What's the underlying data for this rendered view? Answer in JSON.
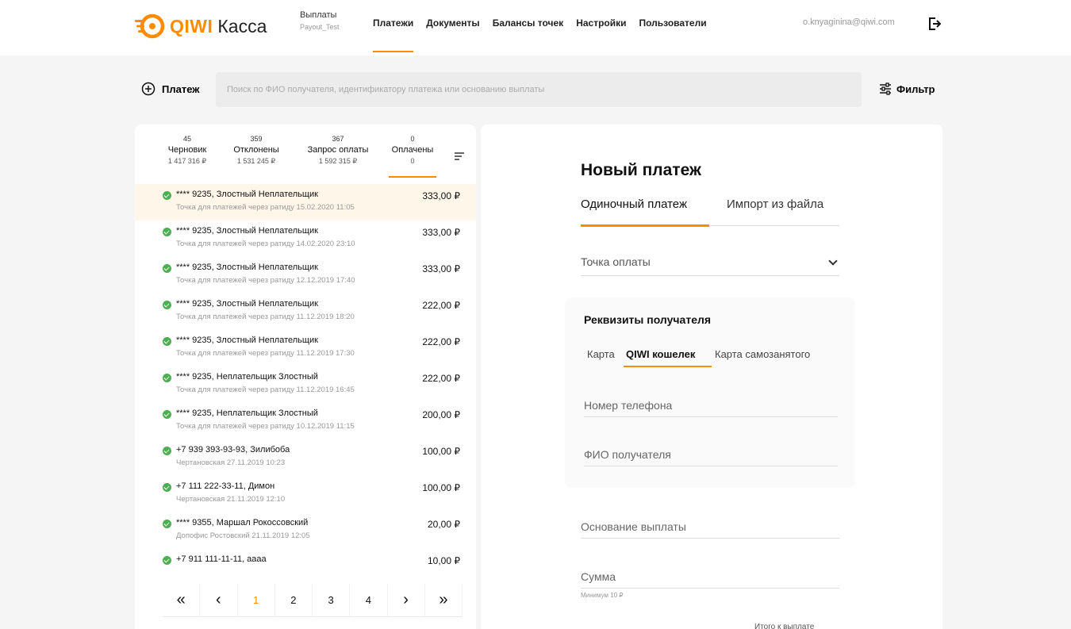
{
  "brand": {
    "name": "QIWI",
    "product": "Касса"
  },
  "payout": {
    "title": "Выплаты",
    "subtitle": "Payout_Test"
  },
  "nav": [
    {
      "label": "Платежи",
      "active": true
    },
    {
      "label": "Документы"
    },
    {
      "label": "Балансы точек"
    },
    {
      "label": "Настройки"
    },
    {
      "label": "Пользователи"
    }
  ],
  "user": {
    "email": "o.knyaginina@qiwi.com"
  },
  "toolbar": {
    "new_payment_label": "Платеж",
    "search_placeholder": "Поиск по ФИО получателя, идентификатору платежа или основанию выплаты",
    "filter_label": "Фильтр"
  },
  "status_tabs": [
    {
      "count": "45",
      "label": "Черновик",
      "sum": "1 417 316 ₽"
    },
    {
      "count": "359",
      "label": "Отклонены",
      "sum": "1 531 245 ₽"
    },
    {
      "count": "367",
      "label": "Запрос оплаты",
      "sum": "1 592 315 ₽"
    },
    {
      "count": "0",
      "label": "Оплачены",
      "sum": "0",
      "active": true
    }
  ],
  "transactions": [
    {
      "title": "**** 9235, Злостный Неплательщик",
      "desc": "Точка для платежей через ратиду 15.02.2020 11:05",
      "amount": "333,00 ₽"
    },
    {
      "title": "**** 9235, Злостный Неплательщик",
      "desc": "Точка для платежей через ратиду 14.02.2020 23:10",
      "amount": "333,00 ₽"
    },
    {
      "title": "**** 9235, Злостный Неплательщик",
      "desc": "Точка для платежей через ратиду 12.12.2019 17:40",
      "amount": "333,00 ₽"
    },
    {
      "title": "**** 9235, Злостный Неплательщик",
      "desc": "Точка для платежей через ратиду 11.12.2019 18:20",
      "amount": "222,00 ₽"
    },
    {
      "title": "**** 9235, Злостный Неплательщик",
      "desc": "Точка для платежей через ратиду 11.12.2019 17:30",
      "amount": "222,00 ₽"
    },
    {
      "title": "**** 9235, Неплательщик Злостный",
      "desc": "Точка для платежей через ратиду 11.12.2019 16:45",
      "amount": "222,00 ₽"
    },
    {
      "title": "**** 9235, Неплательщик Злостный",
      "desc": "Точка для платежей через ратиду 10.12.2019 11:15",
      "amount": "200,00 ₽"
    },
    {
      "title": "+7 939 393-93-93, Зилибоба",
      "desc": "Чертановская 27.11.2019 10:23",
      "amount": "100,00 ₽"
    },
    {
      "title": "+7 111 222-33-11, Димон",
      "desc": "Чертановская 21.11.2019 12:10",
      "amount": "100,00 ₽"
    },
    {
      "title": "**** 9355, Маршал Рокоссовский",
      "desc": "Допофис Ростовский 21.11.2019 12:05",
      "amount": "20,00 ₽"
    },
    {
      "title": "+7 911 111-11-11, аааа",
      "desc": "",
      "amount": "10,00 ₽"
    }
  ],
  "pagination": {
    "first": "«",
    "prev": "‹",
    "pages": [
      "1",
      "2",
      "3",
      "4"
    ],
    "current": "1",
    "next": "›",
    "last": "»"
  },
  "form": {
    "title": "Новый платеж",
    "tab_single": "Одиночный платеж",
    "tab_import": "Импорт из файла",
    "point_label": "Точка оплаты",
    "recipient_title": "Реквизиты получателя",
    "recipient_types": [
      "Карта",
      "QIWI кошелек",
      "Карта самозанятого"
    ],
    "phone_placeholder": "Номер телефона",
    "fio_placeholder": "ФИО получателя",
    "reason_placeholder": "Основание выплаты",
    "amount_placeholder": "Сумма",
    "amount_hint": "Минимум 10 ₽",
    "bottom_link": "Итого к выплате"
  },
  "colors": {
    "accent": "#ff8c00",
    "success": "#4caf50",
    "selected_row": "#fff6ea"
  }
}
